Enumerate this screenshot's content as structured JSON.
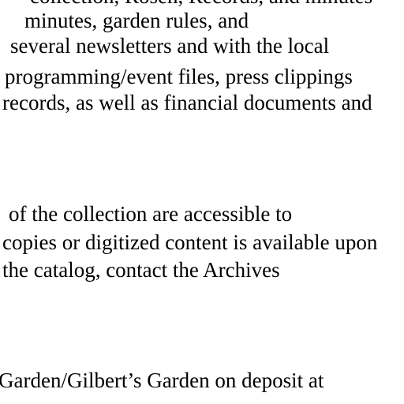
{
  "document": {
    "paragraph1": [
      "collection, Rosen, Records, and minutes",
      "minutes, garden rules, and",
      "several newsletters and with the local",
      "programming/event files, press clippings",
      "records, as well as financial documents and"
    ],
    "paragraph2": [
      "of the collection are accessible to",
      "copies or digitized content is available upon",
      "the catalog, contact the Archives"
    ],
    "paragraph3": [
      "Garden/Gilbert’s Garden on deposit at"
    ]
  }
}
